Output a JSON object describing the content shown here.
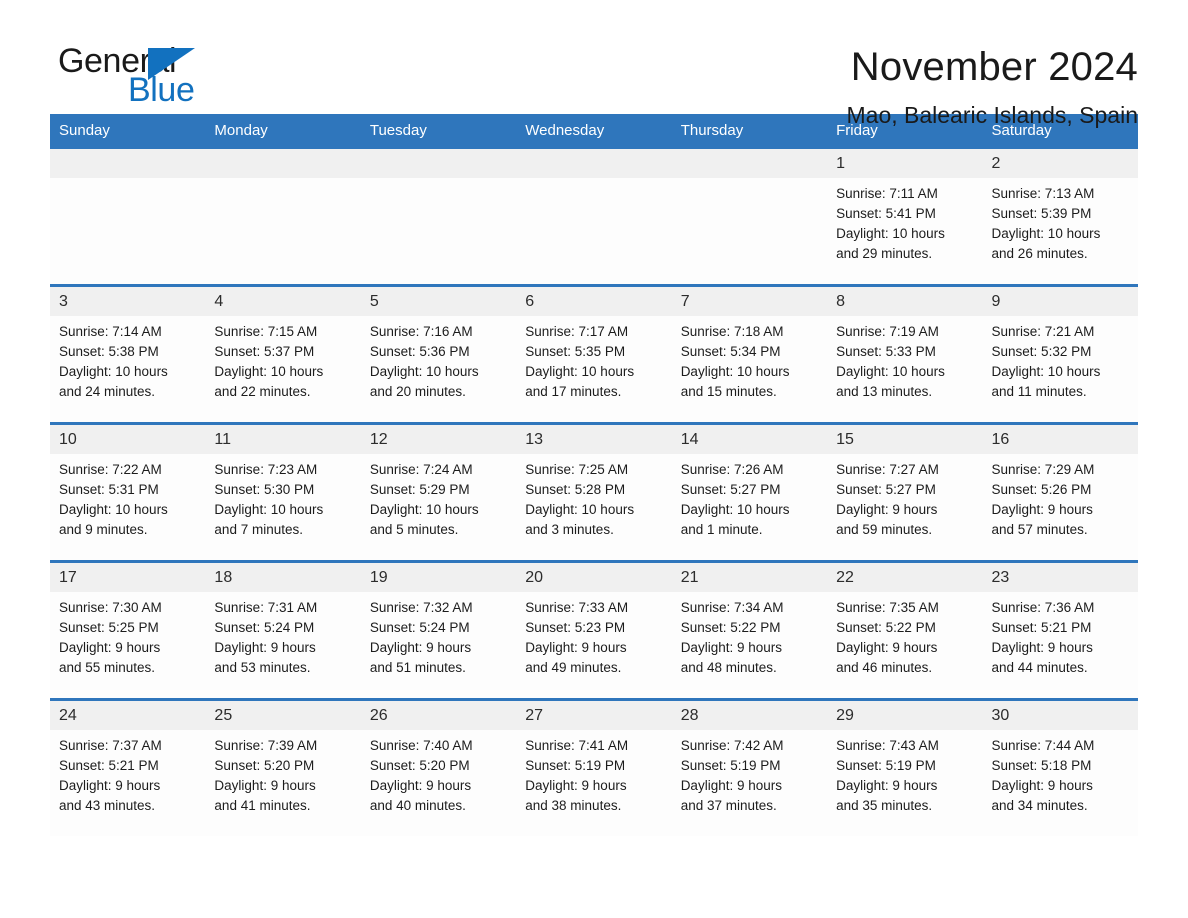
{
  "brand": {
    "word_general": "General",
    "word_blue": "Blue",
    "triangle_color": "#1271bf"
  },
  "header": {
    "month_title": "November 2024",
    "location": "Mao, Balearic Islands, Spain",
    "accent_color": "#2f76bc",
    "daynum_band_color": "#f0f0f0"
  },
  "weekday_headers": [
    "Sunday",
    "Monday",
    "Tuesday",
    "Wednesday",
    "Thursday",
    "Friday",
    "Saturday"
  ],
  "weeks": [
    [
      {
        "day": "",
        "empty": true
      },
      {
        "day": "",
        "empty": true
      },
      {
        "day": "",
        "empty": true
      },
      {
        "day": "",
        "empty": true
      },
      {
        "day": "",
        "empty": true
      },
      {
        "day": "1",
        "sunrise": "Sunrise: 7:11 AM",
        "sunset": "Sunset: 5:41 PM",
        "daylight_line1": "Daylight: 10 hours",
        "daylight_line2": "and 29 minutes."
      },
      {
        "day": "2",
        "sunrise": "Sunrise: 7:13 AM",
        "sunset": "Sunset: 5:39 PM",
        "daylight_line1": "Daylight: 10 hours",
        "daylight_line2": "and 26 minutes."
      }
    ],
    [
      {
        "day": "3",
        "sunrise": "Sunrise: 7:14 AM",
        "sunset": "Sunset: 5:38 PM",
        "daylight_line1": "Daylight: 10 hours",
        "daylight_line2": "and 24 minutes."
      },
      {
        "day": "4",
        "sunrise": "Sunrise: 7:15 AM",
        "sunset": "Sunset: 5:37 PM",
        "daylight_line1": "Daylight: 10 hours",
        "daylight_line2": "and 22 minutes."
      },
      {
        "day": "5",
        "sunrise": "Sunrise: 7:16 AM",
        "sunset": "Sunset: 5:36 PM",
        "daylight_line1": "Daylight: 10 hours",
        "daylight_line2": "and 20 minutes."
      },
      {
        "day": "6",
        "sunrise": "Sunrise: 7:17 AM",
        "sunset": "Sunset: 5:35 PM",
        "daylight_line1": "Daylight: 10 hours",
        "daylight_line2": "and 17 minutes."
      },
      {
        "day": "7",
        "sunrise": "Sunrise: 7:18 AM",
        "sunset": "Sunset: 5:34 PM",
        "daylight_line1": "Daylight: 10 hours",
        "daylight_line2": "and 15 minutes."
      },
      {
        "day": "8",
        "sunrise": "Sunrise: 7:19 AM",
        "sunset": "Sunset: 5:33 PM",
        "daylight_line1": "Daylight: 10 hours",
        "daylight_line2": "and 13 minutes."
      },
      {
        "day": "9",
        "sunrise": "Sunrise: 7:21 AM",
        "sunset": "Sunset: 5:32 PM",
        "daylight_line1": "Daylight: 10 hours",
        "daylight_line2": "and 11 minutes."
      }
    ],
    [
      {
        "day": "10",
        "sunrise": "Sunrise: 7:22 AM",
        "sunset": "Sunset: 5:31 PM",
        "daylight_line1": "Daylight: 10 hours",
        "daylight_line2": "and 9 minutes."
      },
      {
        "day": "11",
        "sunrise": "Sunrise: 7:23 AM",
        "sunset": "Sunset: 5:30 PM",
        "daylight_line1": "Daylight: 10 hours",
        "daylight_line2": "and 7 minutes."
      },
      {
        "day": "12",
        "sunrise": "Sunrise: 7:24 AM",
        "sunset": "Sunset: 5:29 PM",
        "daylight_line1": "Daylight: 10 hours",
        "daylight_line2": "and 5 minutes."
      },
      {
        "day": "13",
        "sunrise": "Sunrise: 7:25 AM",
        "sunset": "Sunset: 5:28 PM",
        "daylight_line1": "Daylight: 10 hours",
        "daylight_line2": "and 3 minutes."
      },
      {
        "day": "14",
        "sunrise": "Sunrise: 7:26 AM",
        "sunset": "Sunset: 5:27 PM",
        "daylight_line1": "Daylight: 10 hours",
        "daylight_line2": "and 1 minute."
      },
      {
        "day": "15",
        "sunrise": "Sunrise: 7:27 AM",
        "sunset": "Sunset: 5:27 PM",
        "daylight_line1": "Daylight: 9 hours",
        "daylight_line2": "and 59 minutes."
      },
      {
        "day": "16",
        "sunrise": "Sunrise: 7:29 AM",
        "sunset": "Sunset: 5:26 PM",
        "daylight_line1": "Daylight: 9 hours",
        "daylight_line2": "and 57 minutes."
      }
    ],
    [
      {
        "day": "17",
        "sunrise": "Sunrise: 7:30 AM",
        "sunset": "Sunset: 5:25 PM",
        "daylight_line1": "Daylight: 9 hours",
        "daylight_line2": "and 55 minutes."
      },
      {
        "day": "18",
        "sunrise": "Sunrise: 7:31 AM",
        "sunset": "Sunset: 5:24 PM",
        "daylight_line1": "Daylight: 9 hours",
        "daylight_line2": "and 53 minutes."
      },
      {
        "day": "19",
        "sunrise": "Sunrise: 7:32 AM",
        "sunset": "Sunset: 5:24 PM",
        "daylight_line1": "Daylight: 9 hours",
        "daylight_line2": "and 51 minutes."
      },
      {
        "day": "20",
        "sunrise": "Sunrise: 7:33 AM",
        "sunset": "Sunset: 5:23 PM",
        "daylight_line1": "Daylight: 9 hours",
        "daylight_line2": "and 49 minutes."
      },
      {
        "day": "21",
        "sunrise": "Sunrise: 7:34 AM",
        "sunset": "Sunset: 5:22 PM",
        "daylight_line1": "Daylight: 9 hours",
        "daylight_line2": "and 48 minutes."
      },
      {
        "day": "22",
        "sunrise": "Sunrise: 7:35 AM",
        "sunset": "Sunset: 5:22 PM",
        "daylight_line1": "Daylight: 9 hours",
        "daylight_line2": "and 46 minutes."
      },
      {
        "day": "23",
        "sunrise": "Sunrise: 7:36 AM",
        "sunset": "Sunset: 5:21 PM",
        "daylight_line1": "Daylight: 9 hours",
        "daylight_line2": "and 44 minutes."
      }
    ],
    [
      {
        "day": "24",
        "sunrise": "Sunrise: 7:37 AM",
        "sunset": "Sunset: 5:21 PM",
        "daylight_line1": "Daylight: 9 hours",
        "daylight_line2": "and 43 minutes."
      },
      {
        "day": "25",
        "sunrise": "Sunrise: 7:39 AM",
        "sunset": "Sunset: 5:20 PM",
        "daylight_line1": "Daylight: 9 hours",
        "daylight_line2": "and 41 minutes."
      },
      {
        "day": "26",
        "sunrise": "Sunrise: 7:40 AM",
        "sunset": "Sunset: 5:20 PM",
        "daylight_line1": "Daylight: 9 hours",
        "daylight_line2": "and 40 minutes."
      },
      {
        "day": "27",
        "sunrise": "Sunrise: 7:41 AM",
        "sunset": "Sunset: 5:19 PM",
        "daylight_line1": "Daylight: 9 hours",
        "daylight_line2": "and 38 minutes."
      },
      {
        "day": "28",
        "sunrise": "Sunrise: 7:42 AM",
        "sunset": "Sunset: 5:19 PM",
        "daylight_line1": "Daylight: 9 hours",
        "daylight_line2": "and 37 minutes."
      },
      {
        "day": "29",
        "sunrise": "Sunrise: 7:43 AM",
        "sunset": "Sunset: 5:19 PM",
        "daylight_line1": "Daylight: 9 hours",
        "daylight_line2": "and 35 minutes."
      },
      {
        "day": "30",
        "sunrise": "Sunrise: 7:44 AM",
        "sunset": "Sunset: 5:18 PM",
        "daylight_line1": "Daylight: 9 hours",
        "daylight_line2": "and 34 minutes."
      }
    ]
  ]
}
